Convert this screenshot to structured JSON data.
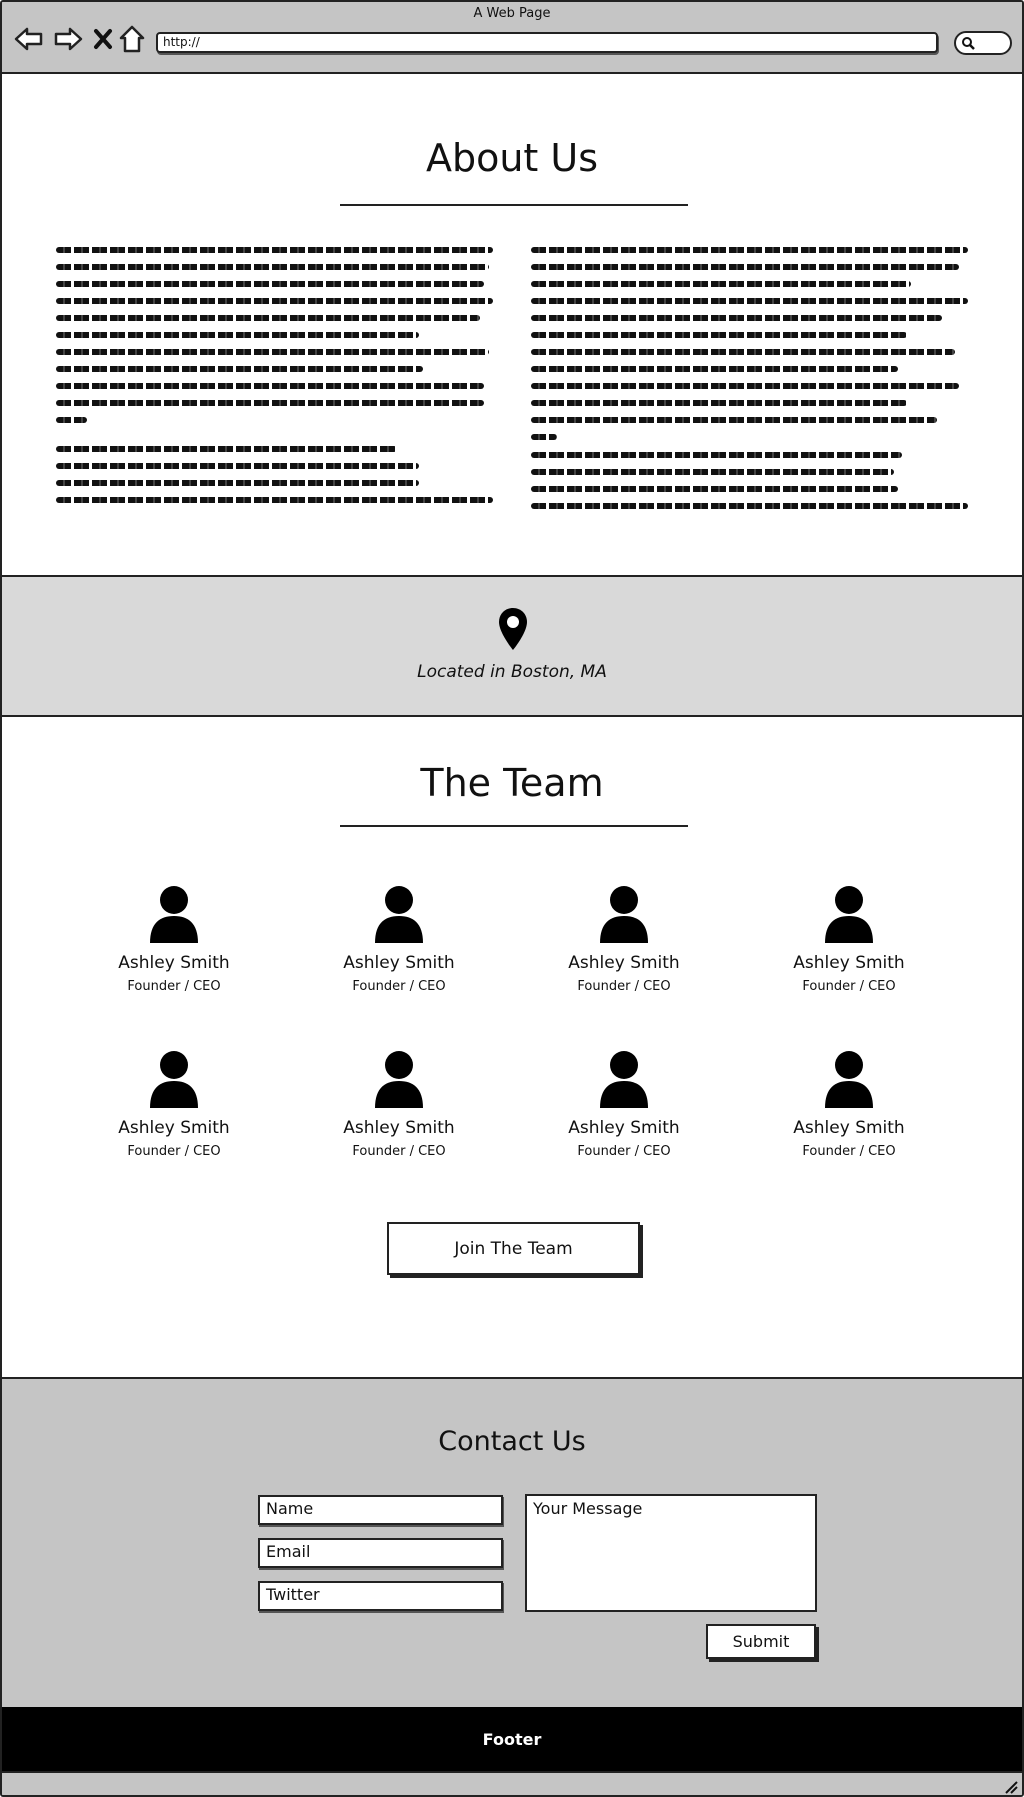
{
  "window": {
    "title": "A Web Page"
  },
  "browser": {
    "url": "http://",
    "icons": [
      "back-arrow-icon",
      "forward-arrow-icon",
      "close-x-icon",
      "home-icon",
      "search-icon"
    ]
  },
  "about": {
    "title": "About Us",
    "left_paragraphs": [
      10,
      4
    ],
    "right_paragraphs": [
      11,
      4
    ]
  },
  "location": {
    "icon": "map-pin-icon",
    "text": "Located in Boston, MA"
  },
  "team": {
    "title": "The Team",
    "members": [
      {
        "name": "Ashley Smith",
        "role": "Founder / CEO"
      },
      {
        "name": "Ashley Smith",
        "role": "Founder / CEO"
      },
      {
        "name": "Ashley Smith",
        "role": "Founder / CEO"
      },
      {
        "name": "Ashley Smith",
        "role": "Founder / CEO"
      },
      {
        "name": "Ashley Smith",
        "role": "Founder / CEO"
      },
      {
        "name": "Ashley Smith",
        "role": "Founder / CEO"
      },
      {
        "name": "Ashley Smith",
        "role": "Founder / CEO"
      },
      {
        "name": "Ashley Smith",
        "role": "Founder / CEO"
      }
    ],
    "join_label": "Join The Team"
  },
  "contact": {
    "title": "Contact Us",
    "name_value": "Name",
    "email_value": "Email",
    "twitter_value": "Twitter",
    "message_value": "Your Message",
    "submit_label": "Submit"
  },
  "footer": {
    "label": "Footer"
  },
  "colors": {
    "chrome": "#c5c5c5",
    "band": "#d9d9d9",
    "footer": "#000000"
  }
}
